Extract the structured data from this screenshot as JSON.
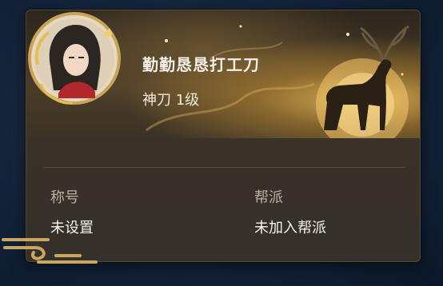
{
  "profile": {
    "name": "勤勤恳恳打工刀",
    "rank": "神刀 1级",
    "avatar_icon": "character-portrait-icon"
  },
  "info": {
    "title_label": "称号",
    "title_value": "未设置",
    "guild_label": "帮派",
    "guild_value": "未加入帮派"
  },
  "colors": {
    "background": "#13233a",
    "card": "#3a3228",
    "accent_gold": "#e0b45a",
    "text_primary": "#f4efe6",
    "text_secondary": "#b8b1a7"
  }
}
